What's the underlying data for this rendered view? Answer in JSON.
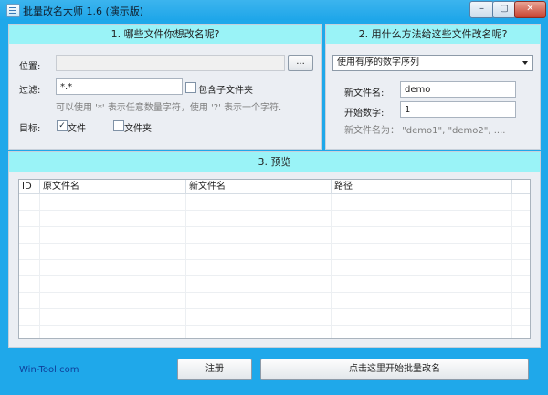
{
  "window": {
    "title": "批量改名大师 1.6 (演示版)",
    "min_label": "–",
    "max_label": "▢",
    "close_label": "✕"
  },
  "section1": {
    "header": "1. 哪些文件你想改名呢?",
    "location_label": "位置:",
    "location_value": "",
    "browse_label": "...",
    "filter_label": "过滤:",
    "filter_value": "*.*",
    "include_subfolders_label": "包含子文件夹",
    "include_subfolders_checked": false,
    "filter_hint": "可以使用 '*' 表示任意数量字符，使用 '?' 表示一个字符.",
    "target_label": "目标:",
    "files_label": "文件",
    "files_checked": true,
    "folders_label": "文件夹",
    "folders_checked": false
  },
  "section2": {
    "header": "2. 用什么方法给这些文件改名呢?",
    "method_selected": "使用有序的数字序列",
    "new_name_label": "新文件名:",
    "new_name_value": "demo",
    "start_number_label": "开始数字:",
    "start_number_value": "1",
    "example": "新文件名为： \"demo1\", \"demo2\", ...."
  },
  "section3": {
    "header": "3. 预览",
    "columns": [
      "ID",
      "原文件名",
      "新文件名",
      "路径"
    ]
  },
  "footer": {
    "link": "Win-Tool.com",
    "register_label": "注册",
    "start_label": "点击这里开始批量改名"
  },
  "colors": {
    "frame": "#1fa8ea",
    "panel": "#ebeef3",
    "section_header": "#9af3f7"
  },
  "icons": [
    "app-icon",
    "minimize-icon",
    "maximize-icon",
    "close-icon",
    "dropdown-arrow-icon",
    "check-icon"
  ]
}
